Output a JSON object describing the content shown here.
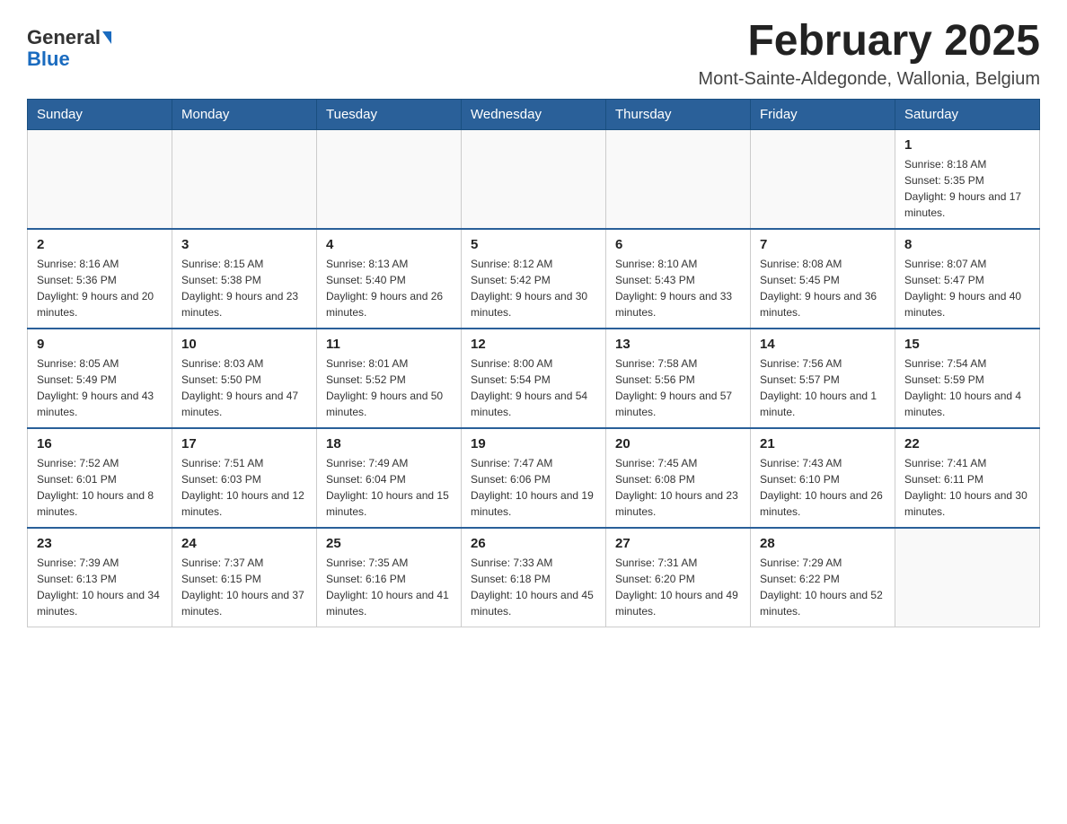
{
  "header": {
    "logo_text_general": "General",
    "logo_text_blue": "Blue",
    "month_title": "February 2025",
    "location": "Mont-Sainte-Aldegonde, Wallonia, Belgium"
  },
  "weekdays": [
    "Sunday",
    "Monday",
    "Tuesday",
    "Wednesday",
    "Thursday",
    "Friday",
    "Saturday"
  ],
  "weeks": [
    [
      {
        "day": "",
        "info": ""
      },
      {
        "day": "",
        "info": ""
      },
      {
        "day": "",
        "info": ""
      },
      {
        "day": "",
        "info": ""
      },
      {
        "day": "",
        "info": ""
      },
      {
        "day": "",
        "info": ""
      },
      {
        "day": "1",
        "info": "Sunrise: 8:18 AM\nSunset: 5:35 PM\nDaylight: 9 hours and 17 minutes."
      }
    ],
    [
      {
        "day": "2",
        "info": "Sunrise: 8:16 AM\nSunset: 5:36 PM\nDaylight: 9 hours and 20 minutes."
      },
      {
        "day": "3",
        "info": "Sunrise: 8:15 AM\nSunset: 5:38 PM\nDaylight: 9 hours and 23 minutes."
      },
      {
        "day": "4",
        "info": "Sunrise: 8:13 AM\nSunset: 5:40 PM\nDaylight: 9 hours and 26 minutes."
      },
      {
        "day": "5",
        "info": "Sunrise: 8:12 AM\nSunset: 5:42 PM\nDaylight: 9 hours and 30 minutes."
      },
      {
        "day": "6",
        "info": "Sunrise: 8:10 AM\nSunset: 5:43 PM\nDaylight: 9 hours and 33 minutes."
      },
      {
        "day": "7",
        "info": "Sunrise: 8:08 AM\nSunset: 5:45 PM\nDaylight: 9 hours and 36 minutes."
      },
      {
        "day": "8",
        "info": "Sunrise: 8:07 AM\nSunset: 5:47 PM\nDaylight: 9 hours and 40 minutes."
      }
    ],
    [
      {
        "day": "9",
        "info": "Sunrise: 8:05 AM\nSunset: 5:49 PM\nDaylight: 9 hours and 43 minutes."
      },
      {
        "day": "10",
        "info": "Sunrise: 8:03 AM\nSunset: 5:50 PM\nDaylight: 9 hours and 47 minutes."
      },
      {
        "day": "11",
        "info": "Sunrise: 8:01 AM\nSunset: 5:52 PM\nDaylight: 9 hours and 50 minutes."
      },
      {
        "day": "12",
        "info": "Sunrise: 8:00 AM\nSunset: 5:54 PM\nDaylight: 9 hours and 54 minutes."
      },
      {
        "day": "13",
        "info": "Sunrise: 7:58 AM\nSunset: 5:56 PM\nDaylight: 9 hours and 57 minutes."
      },
      {
        "day": "14",
        "info": "Sunrise: 7:56 AM\nSunset: 5:57 PM\nDaylight: 10 hours and 1 minute."
      },
      {
        "day": "15",
        "info": "Sunrise: 7:54 AM\nSunset: 5:59 PM\nDaylight: 10 hours and 4 minutes."
      }
    ],
    [
      {
        "day": "16",
        "info": "Sunrise: 7:52 AM\nSunset: 6:01 PM\nDaylight: 10 hours and 8 minutes."
      },
      {
        "day": "17",
        "info": "Sunrise: 7:51 AM\nSunset: 6:03 PM\nDaylight: 10 hours and 12 minutes."
      },
      {
        "day": "18",
        "info": "Sunrise: 7:49 AM\nSunset: 6:04 PM\nDaylight: 10 hours and 15 minutes."
      },
      {
        "day": "19",
        "info": "Sunrise: 7:47 AM\nSunset: 6:06 PM\nDaylight: 10 hours and 19 minutes."
      },
      {
        "day": "20",
        "info": "Sunrise: 7:45 AM\nSunset: 6:08 PM\nDaylight: 10 hours and 23 minutes."
      },
      {
        "day": "21",
        "info": "Sunrise: 7:43 AM\nSunset: 6:10 PM\nDaylight: 10 hours and 26 minutes."
      },
      {
        "day": "22",
        "info": "Sunrise: 7:41 AM\nSunset: 6:11 PM\nDaylight: 10 hours and 30 minutes."
      }
    ],
    [
      {
        "day": "23",
        "info": "Sunrise: 7:39 AM\nSunset: 6:13 PM\nDaylight: 10 hours and 34 minutes."
      },
      {
        "day": "24",
        "info": "Sunrise: 7:37 AM\nSunset: 6:15 PM\nDaylight: 10 hours and 37 minutes."
      },
      {
        "day": "25",
        "info": "Sunrise: 7:35 AM\nSunset: 6:16 PM\nDaylight: 10 hours and 41 minutes."
      },
      {
        "day": "26",
        "info": "Sunrise: 7:33 AM\nSunset: 6:18 PM\nDaylight: 10 hours and 45 minutes."
      },
      {
        "day": "27",
        "info": "Sunrise: 7:31 AM\nSunset: 6:20 PM\nDaylight: 10 hours and 49 minutes."
      },
      {
        "day": "28",
        "info": "Sunrise: 7:29 AM\nSunset: 6:22 PM\nDaylight: 10 hours and 52 minutes."
      },
      {
        "day": "",
        "info": ""
      }
    ]
  ]
}
